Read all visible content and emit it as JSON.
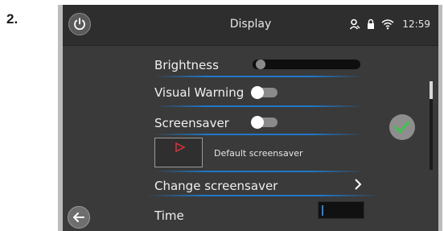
{
  "step_label": "2.",
  "header": {
    "title": "Display",
    "status_icons": [
      "user-icon",
      "lock-icon",
      "wifi-icon"
    ],
    "clock": "12:59"
  },
  "settings": {
    "brightness": {
      "label": "Brightness",
      "level": 0.03
    },
    "visual_warning": {
      "label": "Visual Warning",
      "on": false
    },
    "screensaver": {
      "label": "Screensaver",
      "on": false
    },
    "screensaver_preview": {
      "label": "Default screensaver"
    },
    "change_screensaver": {
      "label": "Change screensaver"
    },
    "time": {
      "label": "Time",
      "value": ""
    }
  },
  "icons": {
    "power": "power-icon",
    "back": "back-arrow-icon",
    "confirm": "checkmark-icon",
    "chevron": "chevron-right-icon"
  },
  "colors": {
    "accent": "#1f78c8",
    "confirm_check": "#3ec44a",
    "screen_background": "#3a3a3a"
  }
}
